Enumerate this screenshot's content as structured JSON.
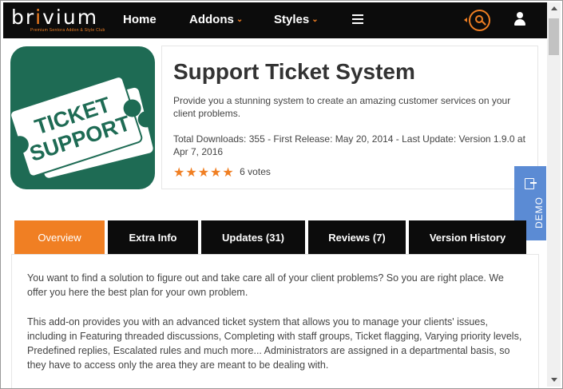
{
  "brand": {
    "name_prefix": "br",
    "name_o": "i",
    "name_rest": "vium",
    "tagline": "Premium Sentora Addon & Style Club",
    "accent_color": "#f07f23",
    "nav_bg": "#0c0c0c"
  },
  "nav": {
    "home": "Home",
    "addons": "Addons",
    "styles": "Styles",
    "menu_icon": "hamburger-icon",
    "search_icon": "search-icon",
    "user_icon": "user-icon"
  },
  "product": {
    "icon_line1": "TICKET",
    "icon_line2": "SUPPORT",
    "icon_bg": "#1e6b54",
    "title": "Support Ticket System",
    "description": "Provide you a stunning system to create an amazing customer services on your client problems.",
    "meta": "Total Downloads: 355 - First Release: May 20, 2014 - Last Update: Version 1.9.0 at Apr 7, 2016",
    "rating": 5,
    "votes": "6 votes"
  },
  "demo": {
    "label": "DEMO",
    "color": "#5b8bd4"
  },
  "tabs": [
    {
      "label": "Overview"
    },
    {
      "label": "Extra Info"
    },
    {
      "label": "Updates (31)"
    },
    {
      "label": "Reviews (7)"
    },
    {
      "label": "Version History"
    }
  ],
  "content": {
    "para1": "You want to find a solution to figure out and take care all of your client problems? So you are right place. We offer you here the best plan for your own problem.",
    "para2": "This add-on provides you with an advanced ticket system that allows you to manage your clients' issues, including in Featuring threaded discussions, Completing with staff groups, Ticket flagging, Varying priority levels, Predefined replies, Escalated rules and much more... Administrators are assigned in a departmental basis, so they have to access only the area they are meant to be dealing with."
  }
}
